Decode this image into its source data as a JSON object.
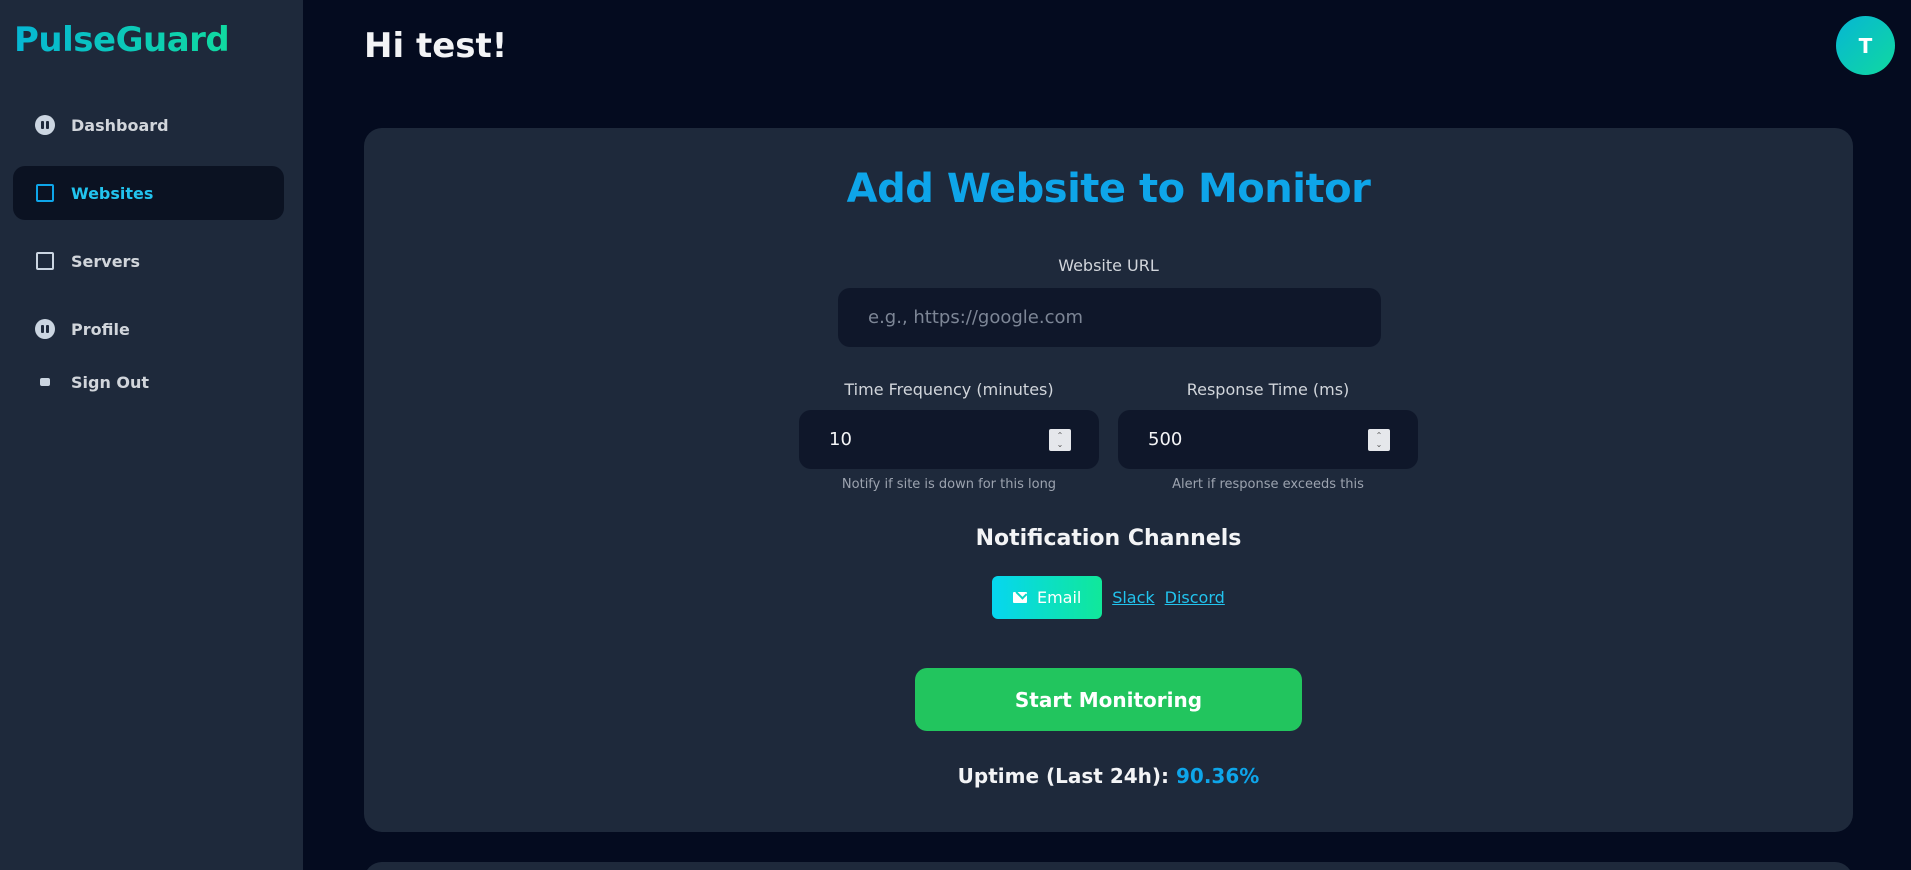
{
  "sidebar": {
    "brand": "PulseGuard",
    "items": [
      {
        "label": "Dashboard",
        "icon": "dashboard-icon"
      },
      {
        "label": "Websites",
        "icon": "square-icon",
        "active": true
      },
      {
        "label": "Servers",
        "icon": "square-icon"
      },
      {
        "label": "Profile",
        "icon": "profile-icon"
      },
      {
        "label": "Sign Out",
        "icon": "sign-out-icon"
      }
    ]
  },
  "header": {
    "greeting": "Hi test!",
    "avatar_initial": "T"
  },
  "form": {
    "title": "Add Website to Monitor",
    "url_label": "Website URL",
    "url_placeholder": "e.g., https://google.com",
    "url_value": "",
    "frequency_label": "Time Frequency (minutes)",
    "frequency_value": "10",
    "frequency_hint": "Notify if site is down for this long",
    "response_label": "Response Time (ms)",
    "response_value": "500",
    "response_hint": "Alert if response exceeds this",
    "channels_title": "Notification Channels",
    "channels": {
      "email": "Email",
      "slack": "Slack",
      "discord": "Discord"
    },
    "submit_label": "Start Monitoring",
    "uptime_label": "Uptime (Last 24h):",
    "uptime_value": "90.36%"
  },
  "colors": {
    "accent": "#0ea5e9",
    "success": "#22c55e",
    "sidebar_bg": "#1e293b",
    "page_bg": "#040b1f"
  }
}
